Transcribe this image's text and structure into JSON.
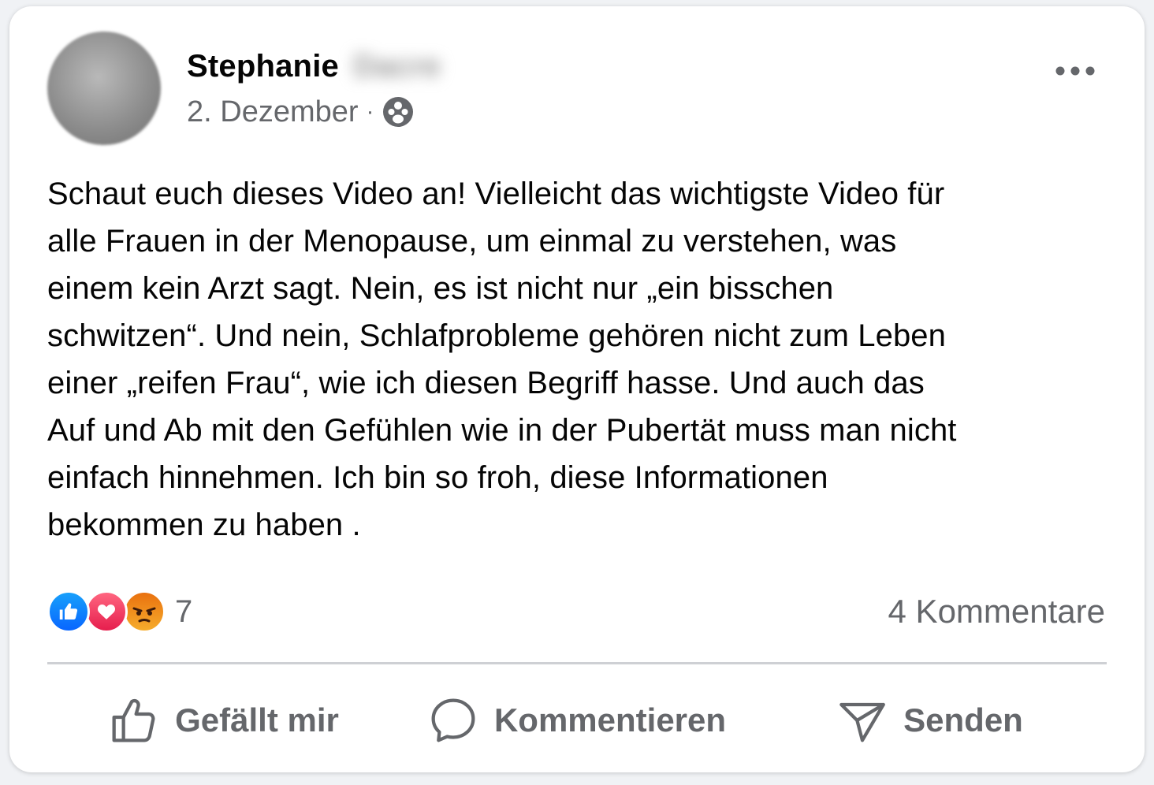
{
  "post": {
    "author": {
      "first_name": "Stephanie",
      "last_name_redacted": "Dacre"
    },
    "date": "2. Dezember",
    "separator": "·",
    "audience_icon": "group-icon",
    "text": "Schaut euch dieses Video an! Vielleicht das wichtigste Video für\nalle Frauen in der Menopause, um einmal zu verstehen, was\neinem kein Arzt sagt. Nein, es ist nicht nur „ein bisschen\nschwitzen“. Und nein, Schlafprobleme gehören nicht zum Leben\neiner „reifen Frau“, wie ich diesen Begriff hasse. Und auch das\nAuf und Ab mit den Gefühlen wie in der Pubertät muss man nicht\neinfach hinnehmen. Ich bin so froh, diese Informationen\nbekommen zu haben ."
  },
  "reactions": {
    "icons": [
      "like-icon",
      "love-icon",
      "angry-icon"
    ],
    "count": "7"
  },
  "comments": {
    "count_label": "4 Kommentare"
  },
  "actions": {
    "like_label": "Gefällt mir",
    "comment_label": "Kommentieren",
    "share_label": "Senden"
  },
  "colors": {
    "like_blue": "#0866ff",
    "love_red": "#e61e4d",
    "angry_orange": "#e9710f",
    "secondary_text": "#65676b"
  }
}
